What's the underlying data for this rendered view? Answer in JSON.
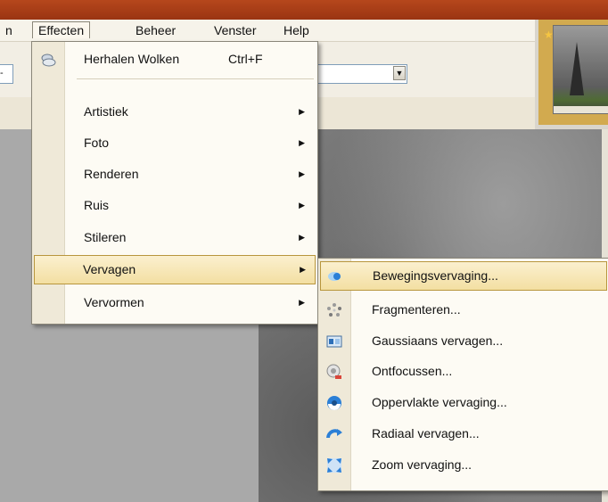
{
  "menubar": {
    "items": [
      {
        "label": "n"
      },
      {
        "label": "Effecten"
      },
      {
        "label": "Beheer"
      },
      {
        "label": "Venster"
      },
      {
        "label": "Help"
      }
    ]
  },
  "effects_menu": {
    "repeat": {
      "label": "Herhalen Wolken",
      "shortcut": "Ctrl+F",
      "icon": "clouds-icon"
    },
    "items": [
      {
        "label": "Artistiek"
      },
      {
        "label": "Foto"
      },
      {
        "label": "Renderen"
      },
      {
        "label": "Ruis"
      },
      {
        "label": "Stileren"
      },
      {
        "label": "Vervagen"
      },
      {
        "label": "Vervormen"
      }
    ]
  },
  "blur_submenu": {
    "items": [
      {
        "label": "Bewegingsvervaging...",
        "icon": "motion-blur-icon"
      },
      {
        "label": "Fragmenteren...",
        "icon": "fragment-icon"
      },
      {
        "label": "Gaussiaans vervagen...",
        "icon": "gaussian-blur-icon"
      },
      {
        "label": "Ontfocussen...",
        "icon": "unfocus-icon"
      },
      {
        "label": "Oppervlakte vervaging...",
        "icon": "surface-blur-icon"
      },
      {
        "label": "Radiaal vervagen...",
        "icon": "radial-blur-icon"
      },
      {
        "label": "Zoom vervaging...",
        "icon": "zoom-blur-icon"
      }
    ]
  },
  "toolbar": {
    "combo_left_value": "-"
  }
}
